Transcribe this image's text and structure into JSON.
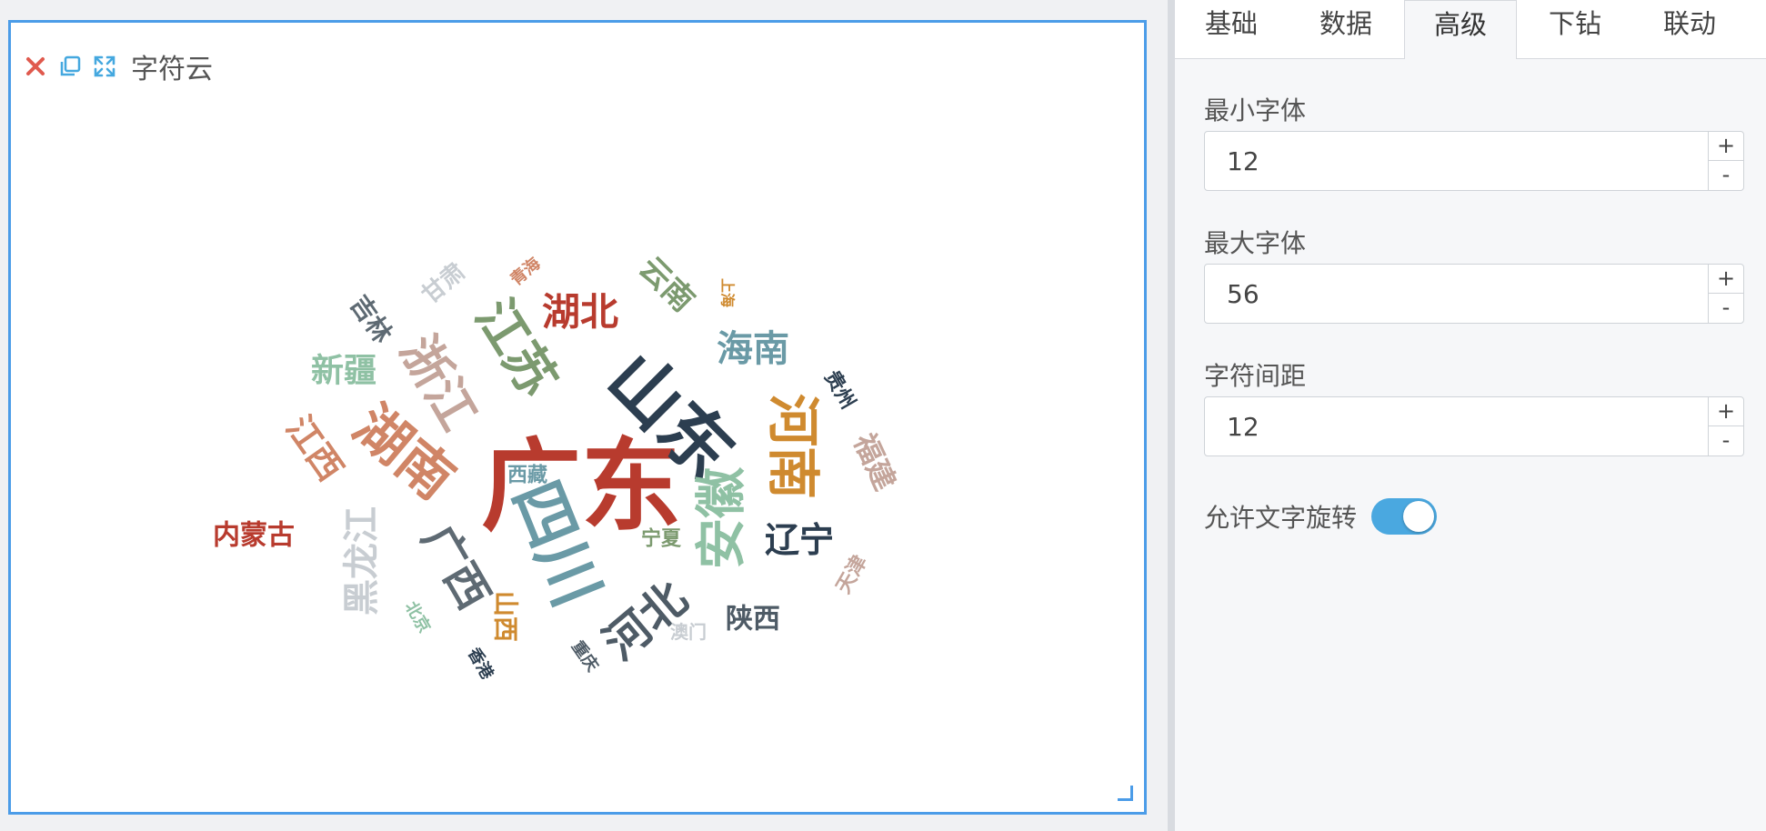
{
  "widget": {
    "title": "字符云",
    "icons": {
      "close": "close-icon",
      "copy": "copy-icon",
      "expand": "expand-icon"
    },
    "colors": {
      "border": "#4b9ce8",
      "close": "#e05a4e",
      "accent": "#45a8df"
    }
  },
  "tabs": [
    {
      "label": "基础",
      "active": false
    },
    {
      "label": "数据",
      "active": false
    },
    {
      "label": "高级",
      "active": true
    },
    {
      "label": "下钻",
      "active": false
    },
    {
      "label": "联动",
      "active": false
    }
  ],
  "settings": {
    "min_font": {
      "label": "最小字体",
      "value": "12"
    },
    "max_font": {
      "label": "最大字体",
      "value": "56"
    },
    "spacing": {
      "label": "字符间距",
      "value": "12"
    },
    "stepper_up": "+",
    "stepper_down": "-",
    "rotate": {
      "label": "允许文字旋转",
      "enabled": true
    }
  },
  "chart_data": {
    "type": "wordcloud",
    "words": [
      {
        "text": "广东",
        "color": "#b83b2e"
      },
      {
        "text": "山东",
        "color": "#2c3e50"
      },
      {
        "text": "四川",
        "color": "#6a9aa6"
      },
      {
        "text": "湖南",
        "color": "#d08566"
      },
      {
        "text": "江苏",
        "color": "#7c9a6f"
      },
      {
        "text": "河南",
        "color": "#cf8a2f"
      },
      {
        "text": "安徽",
        "color": "#8fc1a4"
      },
      {
        "text": "浙江",
        "color": "#c4a59b"
      },
      {
        "text": "河北",
        "color": "#4e5b66"
      },
      {
        "text": "广西",
        "color": "#5e6a73"
      },
      {
        "text": "湖北",
        "color": "#b83b2e"
      },
      {
        "text": "海南",
        "color": "#6a9aa6"
      },
      {
        "text": "黑龙江",
        "color": "#c8cdd2"
      },
      {
        "text": "辽宁",
        "color": "#2c3e50"
      },
      {
        "text": "江西",
        "color": "#d08566"
      },
      {
        "text": "新疆",
        "color": "#8fc1a4"
      },
      {
        "text": "云南",
        "color": "#7c9a6f"
      },
      {
        "text": "福建",
        "color": "#c4a59b"
      },
      {
        "text": "内蒙古",
        "color": "#b83b2e"
      },
      {
        "text": "陕西",
        "color": "#4e5b66"
      },
      {
        "text": "吉林",
        "color": "#5e6a73"
      },
      {
        "text": "山西",
        "color": "#cf8a2f"
      },
      {
        "text": "甘肃",
        "color": "#c8cdd2"
      },
      {
        "text": "贵州",
        "color": "#2c3e50"
      },
      {
        "text": "西藏",
        "color": "#6a9aa6"
      },
      {
        "text": "宁夏",
        "color": "#7c9a6f"
      },
      {
        "text": "天津",
        "color": "#c4a59b"
      },
      {
        "text": "北京",
        "color": "#8fc1a4"
      },
      {
        "text": "青海",
        "color": "#d08566"
      },
      {
        "text": "上海",
        "color": "#cf8a2f"
      },
      {
        "text": "澳门",
        "color": "#c8cdd2"
      },
      {
        "text": "香港",
        "color": "#2c3e50"
      },
      {
        "text": "重庆",
        "color": "#4e5b66"
      }
    ]
  }
}
